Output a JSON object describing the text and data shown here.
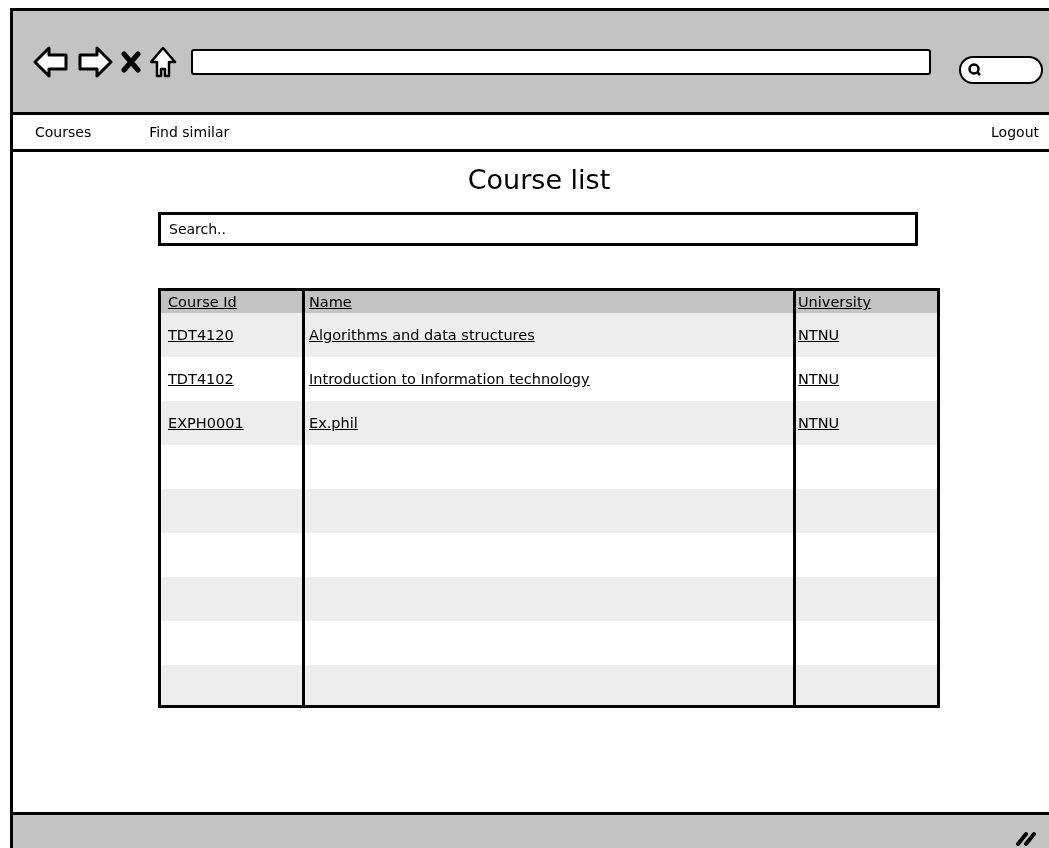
{
  "nav": {
    "left": [
      {
        "label": "Courses"
      },
      {
        "label": "Find similar"
      }
    ],
    "right": [
      {
        "label": "Logout"
      }
    ]
  },
  "title": "Course list",
  "search": {
    "placeholder": "Search.."
  },
  "table": {
    "columns": [
      "Course Id",
      "Name",
      "University"
    ],
    "rows": [
      [
        "TDT4120",
        "Algorithms and data structures",
        "NTNU"
      ],
      [
        "TDT4102",
        "Introduction to Information technology",
        "NTNU"
      ],
      [
        "EXPH0001",
        "Ex.phil",
        "NTNU"
      ]
    ]
  }
}
